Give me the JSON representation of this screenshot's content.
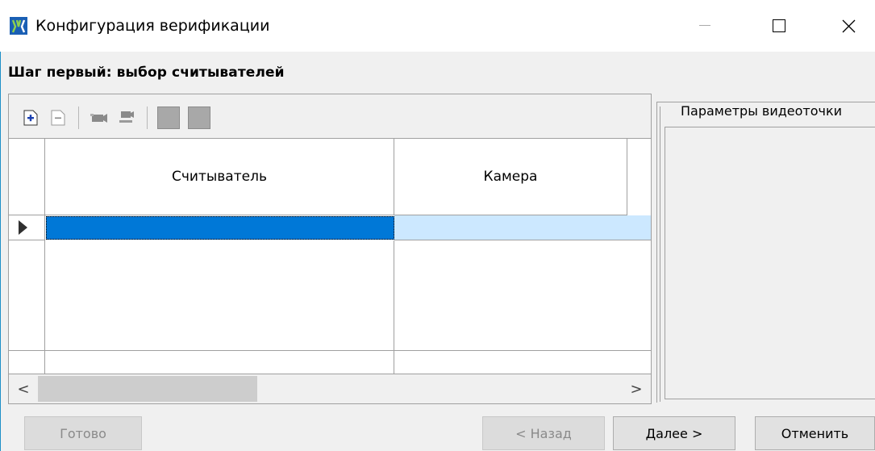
{
  "window": {
    "title": "Конфигурация верификации",
    "icons": {
      "app": "app-logo-icon",
      "minimize": "minimize-icon",
      "maximize": "maximize-icon",
      "close": "close-icon"
    }
  },
  "step": {
    "title": "Шаг первый: выбор считывателей"
  },
  "toolbar": {
    "icons": [
      "add-row-icon",
      "remove-row-icon",
      "camera-icon",
      "camera-link-icon",
      "grey-tool-icon",
      "grey-tool-icon"
    ]
  },
  "grid": {
    "columns": [
      "Считыватель",
      "Камера"
    ],
    "rows": [
      {
        "reader": "",
        "camera": "",
        "selected": true
      }
    ],
    "colors": {
      "selection": "#0078d7",
      "row_highlight": "#cce8ff"
    }
  },
  "scrollbar": {
    "left": "<",
    "right": ">"
  },
  "video_params": {
    "title": "Параметры видеоточки"
  },
  "buttons": {
    "done": "Готово",
    "back": "< Назад",
    "next": "Далее >",
    "cancel": "Отменить"
  }
}
